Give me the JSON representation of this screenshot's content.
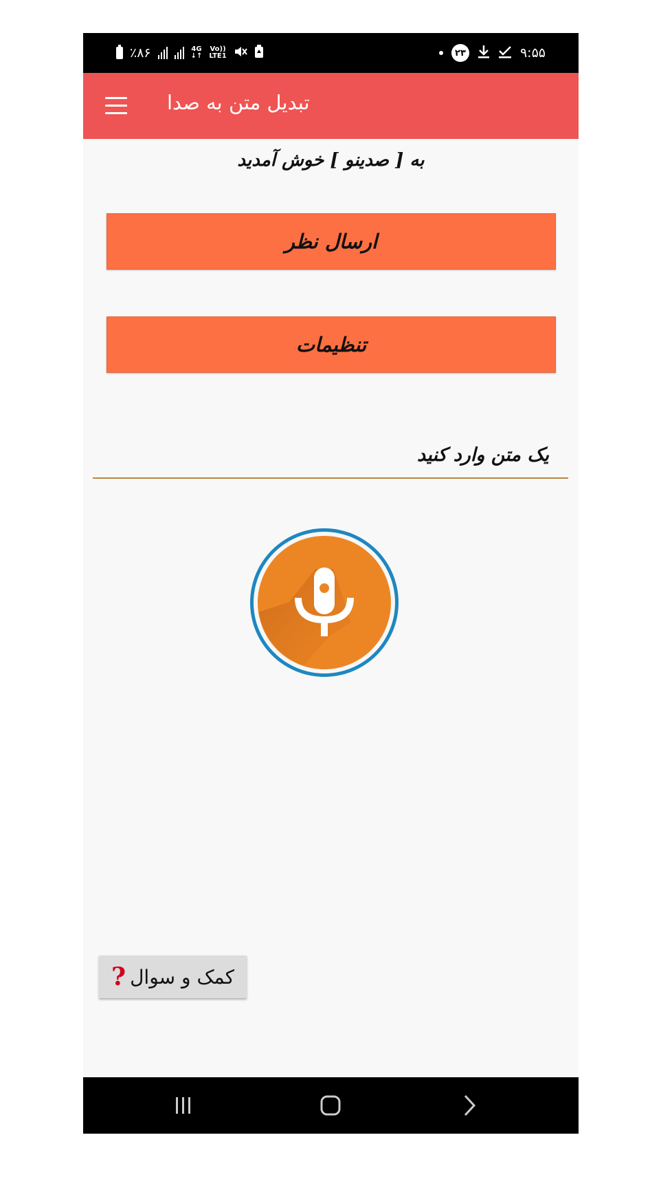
{
  "status_bar": {
    "time": "۹:۵۵",
    "badge_count": "۲۳",
    "battery_percent": "٪۸۶",
    "network": "4G",
    "volte_top": "Vo))",
    "volte_bottom": "LTE1",
    "icons": [
      "battery-icon",
      "signal-icon",
      "signal-icon",
      "4g-icon",
      "volte-icon",
      "mute-icon",
      "battery-saver-icon",
      "dot-icon",
      "notification-badge",
      "download-icon",
      "check-icon"
    ]
  },
  "app_bar": {
    "title": "تبدیل متن به صدا",
    "menu_icon": "hamburger-menu-icon",
    "color": "#ee5453"
  },
  "main": {
    "welcome_text": "به [ صدینو ] خوش آمدید",
    "feedback_button": "ارسال نظر",
    "settings_button": "تنظیمات",
    "text_input_placeholder": "یک متن وارد کنید",
    "text_input_value": "",
    "mic_icon": "microphone-icon",
    "help_button": "کمک و سوال",
    "help_icon": "question-mark-icon",
    "button_color": "#fd7043",
    "mic_color": "#ec8624",
    "mic_ring_color": "#1e87bf"
  },
  "nav_bar": {
    "recents_icon": "recents-icon",
    "home_icon": "home-icon",
    "back_icon": "back-icon"
  }
}
